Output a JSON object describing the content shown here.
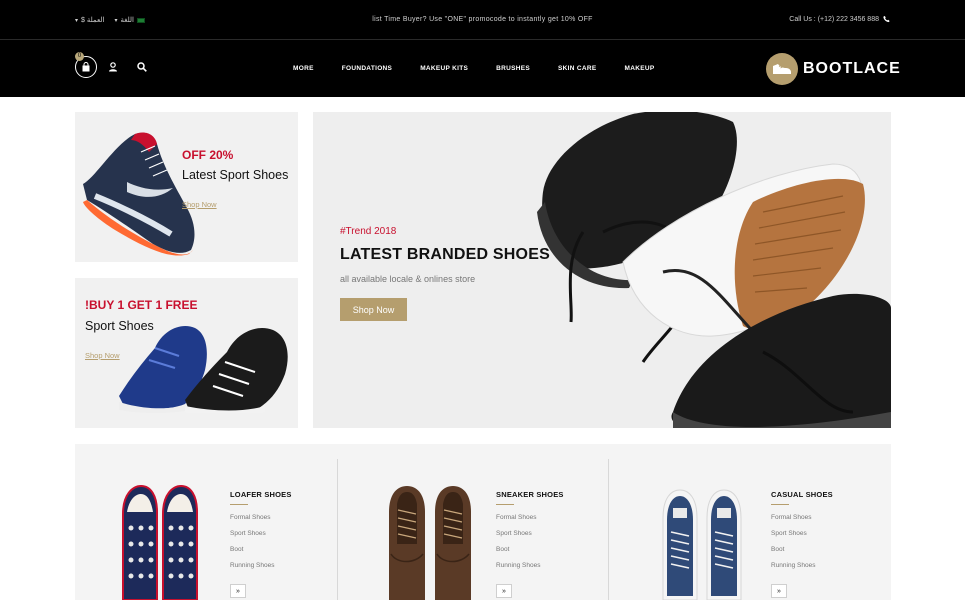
{
  "topbar": {
    "currency": "$ العملة",
    "language": "اللغة",
    "promo": "list Time Buyer? Use \"ONE\" promocode to instantly get 10% OFF",
    "phone": "Call Us : (+12) 222 3456 888"
  },
  "header": {
    "cart_count": "0",
    "menu": [
      "MORE",
      "FOUNDATIONS",
      "MAKEUP KITS",
      "BRUSHES",
      "SKIN CARE",
      "MAKEUP"
    ],
    "logo_text": "BOOTLACE"
  },
  "promos": [
    {
      "accent": "OFF 20%",
      "title": "Latest Sport Shoes",
      "link": "Shop Now"
    },
    {
      "accent": "!BUY 1 GET 1 FREE",
      "title": "Sport Shoes",
      "link": "Shop Now"
    }
  ],
  "hero": {
    "tag": "#Trend 2018",
    "title": "LATEST BRANDED SHOES",
    "subtitle": "all available locale & onlines store",
    "button": "Shop Now"
  },
  "categories": [
    {
      "title": "LOAFER SHOES",
      "links": [
        "Formal Shoes",
        "Sport Shoes",
        "Boot",
        "Running Shoes"
      ],
      "arrow": "»"
    },
    {
      "title": "SNEAKER SHOES",
      "links": [
        "Formal Shoes",
        "Sport Shoes",
        "Boot",
        "Running Shoes"
      ],
      "arrow": "»"
    },
    {
      "title": "CASUAL SHOES",
      "links": [
        "Formal Shoes",
        "Sport Shoes",
        "Boot",
        "Running Shoes"
      ],
      "arrow": "»"
    }
  ],
  "colors": {
    "accent_gold": "#b59e6e",
    "accent_red": "#c8102e",
    "header_bg": "#000000"
  },
  "icons": [
    "flag-icon",
    "phone-icon",
    "cart-icon",
    "user-icon",
    "search-icon",
    "logo-shoe-icon",
    "chevron-right-icon"
  ]
}
